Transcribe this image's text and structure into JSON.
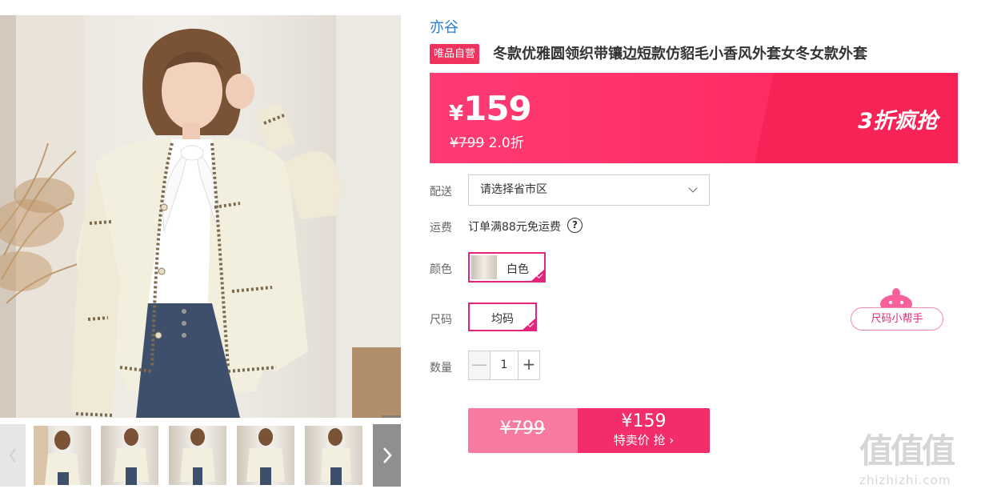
{
  "brand": "亦谷",
  "badge": "唯品自营",
  "title": "冬款优雅圆领织带镶边短款仿貂毛小香风外套女冬女款外套",
  "price": {
    "currency": "¥",
    "current": "159",
    "original": "¥799",
    "discount": "2.0折",
    "promo": "3折疯抢"
  },
  "delivery": {
    "label": "配送",
    "placeholder": "请选择省市区"
  },
  "freight": {
    "label": "运费",
    "text": "订单满88元免运费",
    "help": "?"
  },
  "color": {
    "label": "颜色",
    "options": [
      "白色"
    ],
    "selected": "白色"
  },
  "size": {
    "label": "尺码",
    "options": [
      "均码"
    ],
    "selected": "均码",
    "helper": "尺码小帮手"
  },
  "quantity": {
    "label": "数量",
    "minus": "—",
    "value": "1",
    "plus": "+"
  },
  "buy": {
    "original": "¥799",
    "price": "¥159",
    "action": "特卖价 抢"
  },
  "gallery": {
    "thumbnail_count": 5
  },
  "watermark": {
    "logo": "值值值",
    "url": "zhizhizhi.com"
  },
  "colors": {
    "accent": "#fe2f66",
    "brand_link": "#2f7bd1",
    "selected_border": "#e2247a"
  },
  "icons": [
    "search-icon",
    "chevron-down-icon",
    "question-icon",
    "chevron-left-icon",
    "chevron-right-icon",
    "check-icon"
  ]
}
